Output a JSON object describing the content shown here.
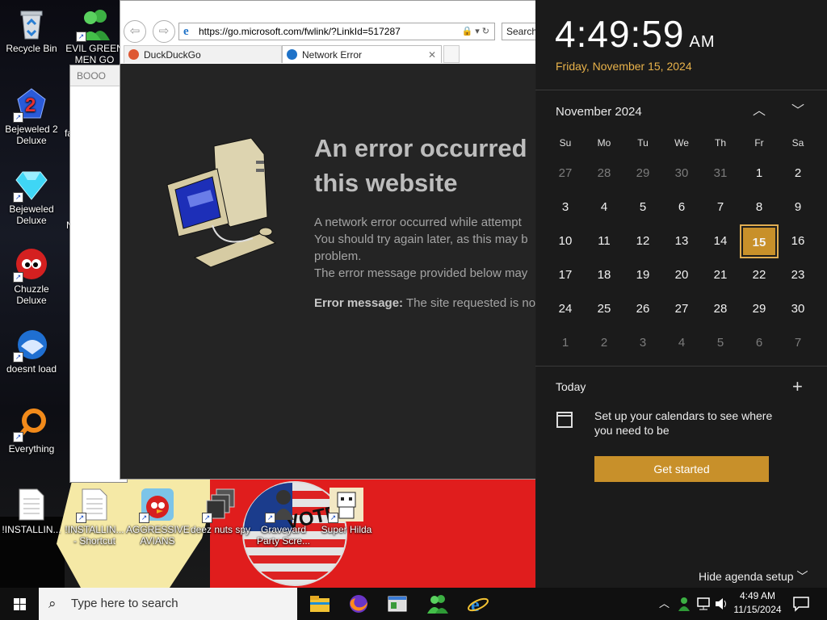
{
  "desktop": {
    "icons": [
      {
        "label": "Recycle Bin",
        "icon": "recycle-bin-icon"
      },
      {
        "label": "EVIL GREEN MEN GO",
        "icon": "messenger-people-icon"
      },
      {
        "label": "Bejeweled 2 Deluxe",
        "icon": "bejeweled-2-icon"
      },
      {
        "label": "Bejeweled Deluxe",
        "icon": "gem-icon"
      },
      {
        "label": "Chuzzle Deluxe",
        "icon": "chuzzle-icon"
      },
      {
        "label": "doesnt load",
        "icon": "thunderbird-icon"
      },
      {
        "label": "Everything",
        "icon": "everything-search-icon"
      },
      {
        "label": "!INSTALLIN...",
        "icon": "text-file-icon"
      },
      {
        "label": "!INSTALLIN... - Shortcut",
        "icon": "text-file-icon"
      },
      {
        "label": "AGGRESSIVE AVIANS",
        "icon": "angry-bird-icon"
      },
      {
        "label": "deez nuts spy",
        "icon": "stacked-windows-icon"
      },
      {
        "label": "Graveyard Party Scre...",
        "icon": "graveyard-icon"
      },
      {
        "label": "Super Hilda",
        "icon": "pixel-character-icon"
      }
    ],
    "partial_labels": {
      "fa": "fa",
      "n": "N"
    },
    "wallpaper_badge_text": "VOTE"
  },
  "browser_back": {
    "title": "BOOO"
  },
  "browser": {
    "address": "https://go.microsoft.com/fwlink/?LinkId=517287",
    "search_placeholder": "Search...",
    "tabs": [
      {
        "label": "DuckDuckGo",
        "active": false
      },
      {
        "label": "Network Error",
        "active": true
      }
    ],
    "error": {
      "title_line1": "An error occurred",
      "title_line2": "this website",
      "body_line1": "A network error occurred while attempt",
      "body_line2": "You should try again later, as this may b",
      "body_line3": "problem.",
      "body_line4": "The error message provided below may",
      "msg_label": "Error message:",
      "msg_text": "The site requested is no"
    }
  },
  "flyout": {
    "time": "4:49:59",
    "ampm": "AM",
    "date": "Friday, November 15, 2024",
    "month_label": "November 2024",
    "weekdays": [
      "Su",
      "Mo",
      "Tu",
      "We",
      "Th",
      "Fr",
      "Sa"
    ],
    "days": [
      {
        "d": "27",
        "dim": true
      },
      {
        "d": "28",
        "dim": true
      },
      {
        "d": "29",
        "dim": true
      },
      {
        "d": "30",
        "dim": true
      },
      {
        "d": "31",
        "dim": true
      },
      {
        "d": "1"
      },
      {
        "d": "2"
      },
      {
        "d": "3"
      },
      {
        "d": "4"
      },
      {
        "d": "5"
      },
      {
        "d": "6"
      },
      {
        "d": "7"
      },
      {
        "d": "8"
      },
      {
        "d": "9"
      },
      {
        "d": "10"
      },
      {
        "d": "11"
      },
      {
        "d": "12"
      },
      {
        "d": "13"
      },
      {
        "d": "14"
      },
      {
        "d": "15",
        "today": true
      },
      {
        "d": "16"
      },
      {
        "d": "17"
      },
      {
        "d": "18"
      },
      {
        "d": "19"
      },
      {
        "d": "20"
      },
      {
        "d": "21"
      },
      {
        "d": "22"
      },
      {
        "d": "23"
      },
      {
        "d": "24"
      },
      {
        "d": "25"
      },
      {
        "d": "26"
      },
      {
        "d": "27"
      },
      {
        "d": "28"
      },
      {
        "d": "29"
      },
      {
        "d": "30"
      },
      {
        "d": "1",
        "dim": true
      },
      {
        "d": "2",
        "dim": true
      },
      {
        "d": "3",
        "dim": true
      },
      {
        "d": "4",
        "dim": true
      },
      {
        "d": "5",
        "dim": true
      },
      {
        "d": "6",
        "dim": true
      },
      {
        "d": "7",
        "dim": true
      }
    ],
    "today_heading": "Today",
    "setup_text": "Set up your calendars to see where you need to be",
    "get_started": "Get started",
    "hide_agenda": "Hide agenda setup",
    "accent": "#c8902a"
  },
  "taskbar": {
    "search_placeholder": "Type here to search",
    "apps": [
      "file-explorer-icon",
      "firefox-icon",
      "window-app-icon",
      "messenger-icon",
      "internet-explorer-icon"
    ],
    "clock_time": "4:49 AM",
    "clock_date": "11/15/2024"
  }
}
